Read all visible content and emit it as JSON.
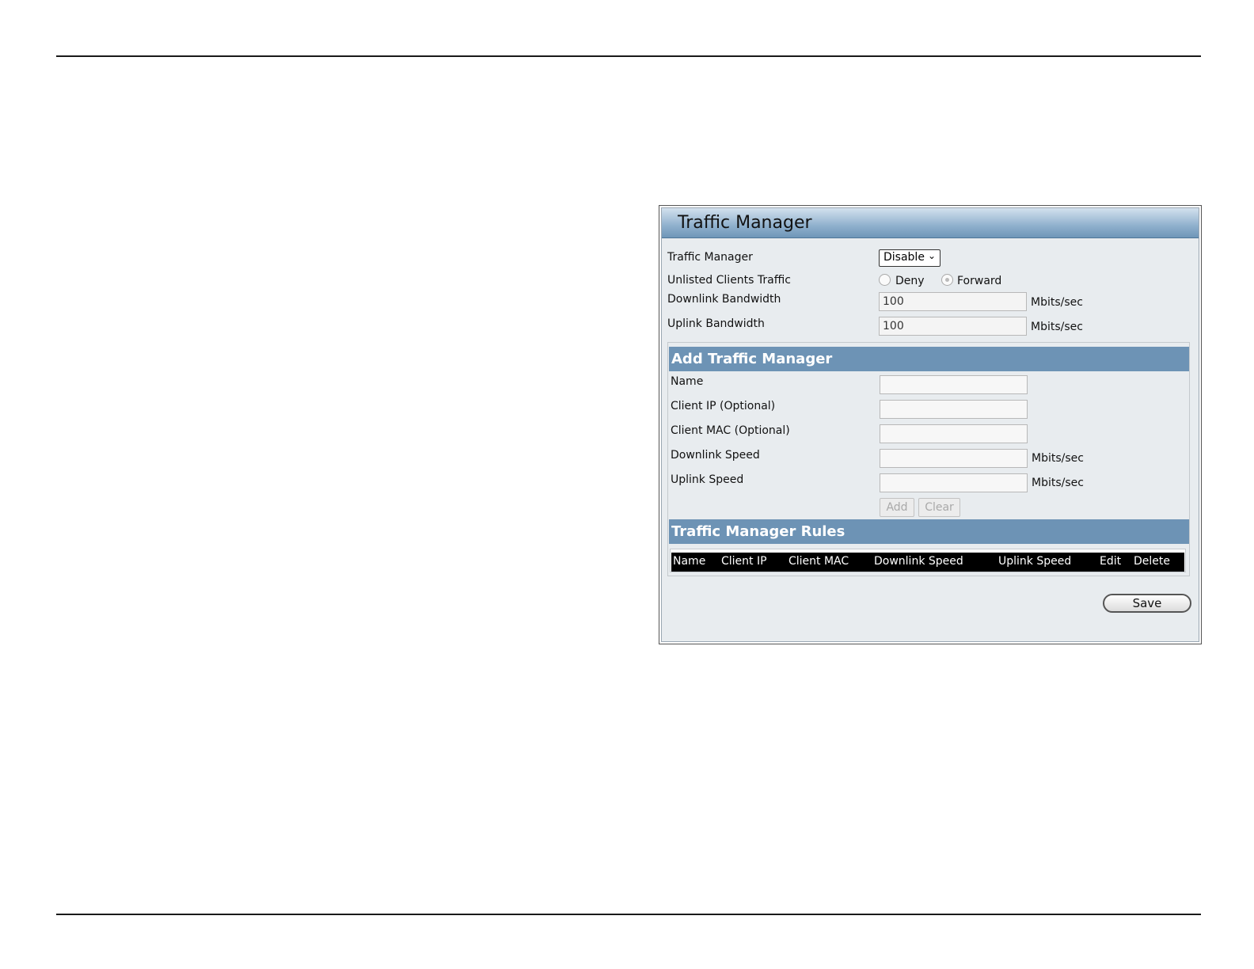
{
  "panel": {
    "title": "Traffic Manager"
  },
  "settings": {
    "traffic_manager_label": "Traffic Manager",
    "traffic_manager_value": "Disable",
    "unlisted_label": "Unlisted Clients Traffic",
    "deny_label": "Deny",
    "forward_label": "Forward",
    "unlisted_selected": "Forward",
    "downlink_label": "Downlink Bandwidth",
    "downlink_value": "100",
    "uplink_label": "Uplink Bandwidth",
    "uplink_value": "100",
    "unit": "Mbits/sec"
  },
  "add_section": {
    "title": "Add Traffic Manager",
    "name_label": "Name",
    "client_ip_label": "Client IP (Optional)",
    "client_mac_label": "Client MAC (Optional)",
    "downlink_speed_label": "Downlink Speed",
    "uplink_speed_label": "Uplink Speed",
    "unit": "Mbits/sec",
    "add_label": "Add",
    "clear_label": "Clear"
  },
  "rules_section": {
    "title": "Traffic Manager Rules",
    "columns": [
      "Name",
      "Client IP",
      "Client MAC",
      "Downlink Speed",
      "Uplink Speed",
      "Edit",
      "Delete"
    ]
  },
  "save_label": "Save"
}
